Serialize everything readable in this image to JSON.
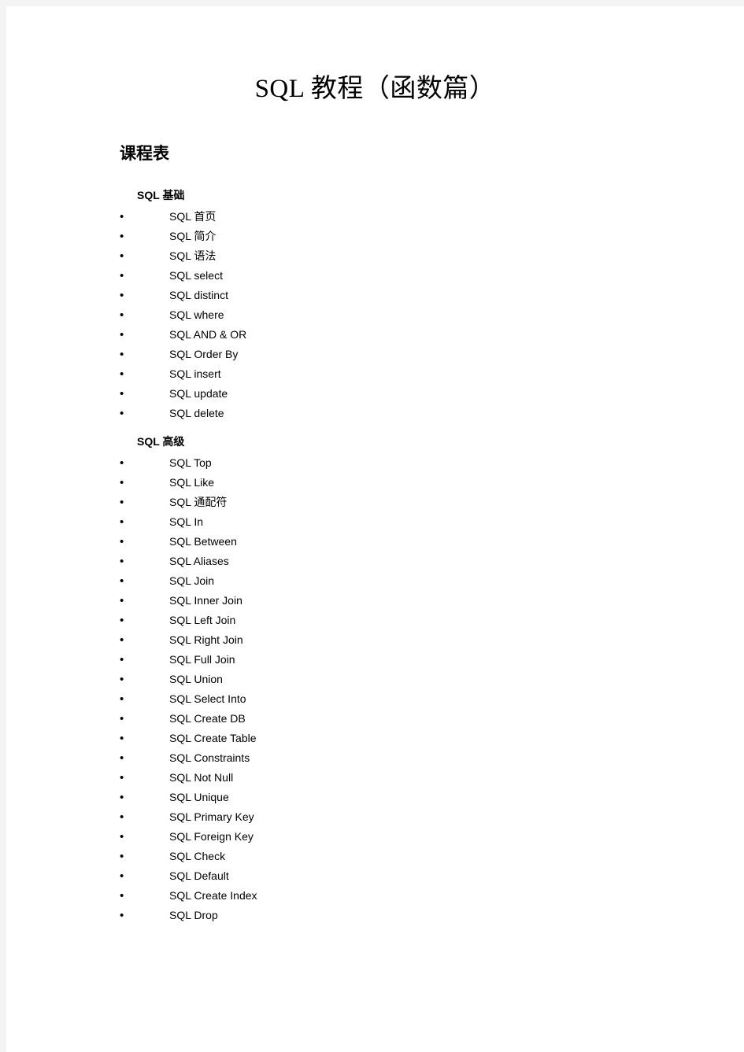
{
  "document": {
    "title": "SQL 教程（函数篇）",
    "section_title": "课程表",
    "groups": [
      {
        "heading": "SQL 基础",
        "items": [
          "SQL 首页",
          "SQL 简介",
          "SQL 语法",
          "SQL select",
          "SQL distinct",
          "SQL where",
          "SQL AND & OR",
          "SQL Order By",
          "SQL insert",
          "SQL update",
          "SQL delete"
        ]
      },
      {
        "heading": "SQL 高级",
        "items": [
          "SQL Top",
          "SQL Like",
          "SQL 通配符",
          "SQL In",
          "SQL Between",
          "SQL Aliases",
          "SQL Join",
          "SQL Inner Join",
          "SQL Left Join",
          "SQL Right Join",
          "SQL Full Join",
          "SQL Union",
          "SQL Select Into",
          "SQL Create DB",
          "SQL Create Table",
          "SQL Constraints",
          "SQL Not Null",
          "SQL Unique",
          "SQL Primary Key",
          "SQL Foreign Key",
          "SQL Check",
          "SQL Default",
          "SQL Create Index",
          "SQL Drop"
        ]
      }
    ]
  },
  "colors": {
    "page_background": "#ffffff",
    "app_background": "#f4f4f4",
    "text": "#000000"
  }
}
